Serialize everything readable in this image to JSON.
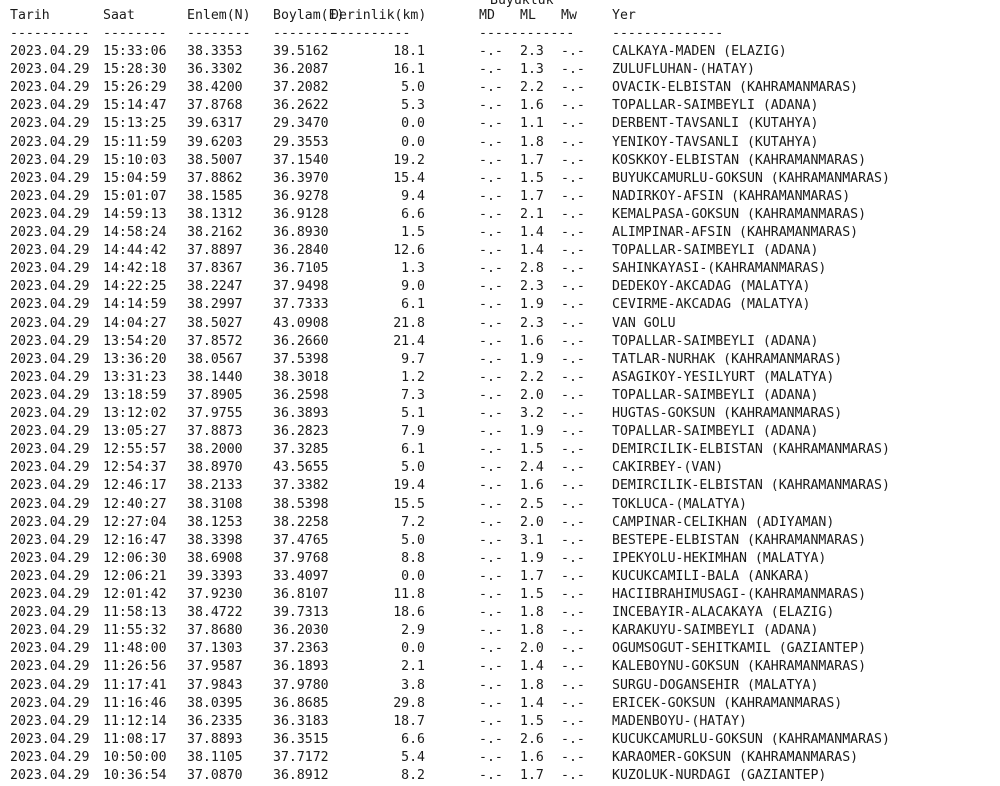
{
  "group_header": "Büyüklük",
  "headers": {
    "date": "Tarih",
    "time": "Saat",
    "lat": "Enlem(N)",
    "lon": "Boylam(E)",
    "depth": "Derinlik(km)",
    "md": "MD",
    "ml": "ML",
    "mw": "Mw",
    "place": "Yer"
  },
  "separators": {
    "date": "----------",
    "time": "--------",
    "lat": "--------",
    "lon": "--------",
    "depth": "----------",
    "mag": "------------",
    "place": "--------------"
  },
  "rows": [
    {
      "date": "2023.04.29",
      "time": "15:33:06",
      "lat": "38.3353",
      "lon": "39.5162",
      "depth": "18.1",
      "md": "-.-",
      "ml": "2.3",
      "mw": "-.-",
      "place": "CALKAYA-MADEN (ELAZIG)"
    },
    {
      "date": "2023.04.29",
      "time": "15:28:30",
      "lat": "36.3302",
      "lon": "36.2087",
      "depth": "16.1",
      "md": "-.-",
      "ml": "1.3",
      "mw": "-.-",
      "place": "ZULUFLUHAN-(HATAY)"
    },
    {
      "date": "2023.04.29",
      "time": "15:26:29",
      "lat": "38.4200",
      "lon": "37.2082",
      "depth": "5.0",
      "md": "-.-",
      "ml": "2.2",
      "mw": "-.-",
      "place": "OVACIK-ELBISTAN (KAHRAMANMARAS)"
    },
    {
      "date": "2023.04.29",
      "time": "15:14:47",
      "lat": "37.8768",
      "lon": "36.2622",
      "depth": "5.3",
      "md": "-.-",
      "ml": "1.6",
      "mw": "-.-",
      "place": "TOPALLAR-SAIMBEYLI (ADANA)"
    },
    {
      "date": "2023.04.29",
      "time": "15:13:25",
      "lat": "39.6317",
      "lon": "29.3470",
      "depth": "0.0",
      "md": "-.-",
      "ml": "1.1",
      "mw": "-.-",
      "place": "DERBENT-TAVSANLI (KUTAHYA)"
    },
    {
      "date": "2023.04.29",
      "time": "15:11:59",
      "lat": "39.6203",
      "lon": "29.3553",
      "depth": "0.0",
      "md": "-.-",
      "ml": "1.8",
      "mw": "-.-",
      "place": "YENIKOY-TAVSANLI (KUTAHYA)"
    },
    {
      "date": "2023.04.29",
      "time": "15:10:03",
      "lat": "38.5007",
      "lon": "37.1540",
      "depth": "19.2",
      "md": "-.-",
      "ml": "1.7",
      "mw": "-.-",
      "place": "KOSKKOY-ELBISTAN (KAHRAMANMARAS)"
    },
    {
      "date": "2023.04.29",
      "time": "15:04:59",
      "lat": "37.8862",
      "lon": "36.3970",
      "depth": "15.4",
      "md": "-.-",
      "ml": "1.5",
      "mw": "-.-",
      "place": "BUYUKCAMURLU-GOKSUN (KAHRAMANMARAS)"
    },
    {
      "date": "2023.04.29",
      "time": "15:01:07",
      "lat": "38.1585",
      "lon": "36.9278",
      "depth": "9.4",
      "md": "-.-",
      "ml": "1.7",
      "mw": "-.-",
      "place": "NADIRKOY-AFSIN (KAHRAMANMARAS)"
    },
    {
      "date": "2023.04.29",
      "time": "14:59:13",
      "lat": "38.1312",
      "lon": "36.9128",
      "depth": "6.6",
      "md": "-.-",
      "ml": "2.1",
      "mw": "-.-",
      "place": "KEMALPASA-GOKSUN (KAHRAMANMARAS)"
    },
    {
      "date": "2023.04.29",
      "time": "14:58:24",
      "lat": "38.2162",
      "lon": "36.8930",
      "depth": "1.5",
      "md": "-.-",
      "ml": "1.4",
      "mw": "-.-",
      "place": "ALIMPINAR-AFSIN (KAHRAMANMARAS)"
    },
    {
      "date": "2023.04.29",
      "time": "14:44:42",
      "lat": "37.8897",
      "lon": "36.2840",
      "depth": "12.6",
      "md": "-.-",
      "ml": "1.4",
      "mw": "-.-",
      "place": "TOPALLAR-SAIMBEYLI (ADANA)"
    },
    {
      "date": "2023.04.29",
      "time": "14:42:18",
      "lat": "37.8367",
      "lon": "36.7105",
      "depth": "1.3",
      "md": "-.-",
      "ml": "2.8",
      "mw": "-.-",
      "place": "SAHINKAYASI-(KAHRAMANMARAS)"
    },
    {
      "date": "2023.04.29",
      "time": "14:22:25",
      "lat": "38.2247",
      "lon": "37.9498",
      "depth": "9.0",
      "md": "-.-",
      "ml": "2.3",
      "mw": "-.-",
      "place": "DEDEKOY-AKCADAG (MALATYA)"
    },
    {
      "date": "2023.04.29",
      "time": "14:14:59",
      "lat": "38.2997",
      "lon": "37.7333",
      "depth": "6.1",
      "md": "-.-",
      "ml": "1.9",
      "mw": "-.-",
      "place": "CEVIRME-AKCADAG (MALATYA)"
    },
    {
      "date": "2023.04.29",
      "time": "14:04:27",
      "lat": "38.5027",
      "lon": "43.0908",
      "depth": "21.8",
      "md": "-.-",
      "ml": "2.3",
      "mw": "-.-",
      "place": "VAN GOLU"
    },
    {
      "date": "2023.04.29",
      "time": "13:54:20",
      "lat": "37.8572",
      "lon": "36.2660",
      "depth": "21.4",
      "md": "-.-",
      "ml": "1.6",
      "mw": "-.-",
      "place": "TOPALLAR-SAIMBEYLI (ADANA)"
    },
    {
      "date": "2023.04.29",
      "time": "13:36:20",
      "lat": "38.0567",
      "lon": "37.5398",
      "depth": "9.7",
      "md": "-.-",
      "ml": "1.9",
      "mw": "-.-",
      "place": "TATLAR-NURHAK (KAHRAMANMARAS)"
    },
    {
      "date": "2023.04.29",
      "time": "13:31:23",
      "lat": "38.1440",
      "lon": "38.3018",
      "depth": "1.2",
      "md": "-.-",
      "ml": "2.2",
      "mw": "-.-",
      "place": "ASAGIKOY-YESILYURT (MALATYA)"
    },
    {
      "date": "2023.04.29",
      "time": "13:18:59",
      "lat": "37.8905",
      "lon": "36.2598",
      "depth": "7.3",
      "md": "-.-",
      "ml": "2.0",
      "mw": "-.-",
      "place": "TOPALLAR-SAIMBEYLI (ADANA)"
    },
    {
      "date": "2023.04.29",
      "time": "13:12:02",
      "lat": "37.9755",
      "lon": "36.3893",
      "depth": "5.1",
      "md": "-.-",
      "ml": "3.2",
      "mw": "-.-",
      "place": "HUGTAS-GOKSUN (KAHRAMANMARAS)"
    },
    {
      "date": "2023.04.29",
      "time": "13:05:27",
      "lat": "37.8873",
      "lon": "36.2823",
      "depth": "7.9",
      "md": "-.-",
      "ml": "1.9",
      "mw": "-.-",
      "place": "TOPALLAR-SAIMBEYLI (ADANA)"
    },
    {
      "date": "2023.04.29",
      "time": "12:55:57",
      "lat": "38.2000",
      "lon": "37.3285",
      "depth": "6.1",
      "md": "-.-",
      "ml": "1.5",
      "mw": "-.-",
      "place": "DEMIRCILIK-ELBISTAN (KAHRAMANMARAS)"
    },
    {
      "date": "2023.04.29",
      "time": "12:54:37",
      "lat": "38.8970",
      "lon": "43.5655",
      "depth": "5.0",
      "md": "-.-",
      "ml": "2.4",
      "mw": "-.-",
      "place": "CAKIRBEY-(VAN)"
    },
    {
      "date": "2023.04.29",
      "time": "12:46:17",
      "lat": "38.2133",
      "lon": "37.3382",
      "depth": "19.4",
      "md": "-.-",
      "ml": "1.6",
      "mw": "-.-",
      "place": "DEMIRCILIK-ELBISTAN (KAHRAMANMARAS)"
    },
    {
      "date": "2023.04.29",
      "time": "12:40:27",
      "lat": "38.3108",
      "lon": "38.5398",
      "depth": "15.5",
      "md": "-.-",
      "ml": "2.5",
      "mw": "-.-",
      "place": "TOKLUCA-(MALATYA)"
    },
    {
      "date": "2023.04.29",
      "time": "12:27:04",
      "lat": "38.1253",
      "lon": "38.2258",
      "depth": "7.2",
      "md": "-.-",
      "ml": "2.0",
      "mw": "-.-",
      "place": "CAMPINAR-CELIKHAN (ADIYAMAN)"
    },
    {
      "date": "2023.04.29",
      "time": "12:16:47",
      "lat": "38.3398",
      "lon": "37.4765",
      "depth": "5.0",
      "md": "-.-",
      "ml": "3.1",
      "mw": "-.-",
      "place": "BESTEPE-ELBISTAN (KAHRAMANMARAS)"
    },
    {
      "date": "2023.04.29",
      "time": "12:06:30",
      "lat": "38.6908",
      "lon": "37.9768",
      "depth": "8.8",
      "md": "-.-",
      "ml": "1.9",
      "mw": "-.-",
      "place": "IPEKYOLU-HEKIMHAN (MALATYA)"
    },
    {
      "date": "2023.04.29",
      "time": "12:06:21",
      "lat": "39.3393",
      "lon": "33.4097",
      "depth": "0.0",
      "md": "-.-",
      "ml": "1.7",
      "mw": "-.-",
      "place": "KUCUKCAMILI-BALA (ANKARA)"
    },
    {
      "date": "2023.04.29",
      "time": "12:01:42",
      "lat": "37.9230",
      "lon": "36.8107",
      "depth": "11.8",
      "md": "-.-",
      "ml": "1.5",
      "mw": "-.-",
      "place": "HACIIBRAHIMUSAGI-(KAHRAMANMARAS)"
    },
    {
      "date": "2023.04.29",
      "time": "11:58:13",
      "lat": "38.4722",
      "lon": "39.7313",
      "depth": "18.6",
      "md": "-.-",
      "ml": "1.8",
      "mw": "-.-",
      "place": "INCEBAYIR-ALACAKAYA (ELAZIG)"
    },
    {
      "date": "2023.04.29",
      "time": "11:55:32",
      "lat": "37.8680",
      "lon": "36.2030",
      "depth": "2.9",
      "md": "-.-",
      "ml": "1.8",
      "mw": "-.-",
      "place": "KARAKUYU-SAIMBEYLI (ADANA)"
    },
    {
      "date": "2023.04.29",
      "time": "11:48:00",
      "lat": "37.1303",
      "lon": "37.2363",
      "depth": "0.0",
      "md": "-.-",
      "ml": "2.0",
      "mw": "-.-",
      "place": "OGUMSOGUT-SEHITKAMIL (GAZIANTEP)"
    },
    {
      "date": "2023.04.29",
      "time": "11:26:56",
      "lat": "37.9587",
      "lon": "36.1893",
      "depth": "2.1",
      "md": "-.-",
      "ml": "1.4",
      "mw": "-.-",
      "place": "KALEBOYNU-GOKSUN (KAHRAMANMARAS)"
    },
    {
      "date": "2023.04.29",
      "time": "11:17:41",
      "lat": "37.9843",
      "lon": "37.9780",
      "depth": "3.8",
      "md": "-.-",
      "ml": "1.8",
      "mw": "-.-",
      "place": "SURGU-DOGANSEHIR (MALATYA)"
    },
    {
      "date": "2023.04.29",
      "time": "11:16:46",
      "lat": "38.0395",
      "lon": "36.8685",
      "depth": "29.8",
      "md": "-.-",
      "ml": "1.4",
      "mw": "-.-",
      "place": "ERICEK-GOKSUN (KAHRAMANMARAS)"
    },
    {
      "date": "2023.04.29",
      "time": "11:12:14",
      "lat": "36.2335",
      "lon": "36.3183",
      "depth": "18.7",
      "md": "-.-",
      "ml": "1.5",
      "mw": "-.-",
      "place": "MADENBOYU-(HATAY)"
    },
    {
      "date": "2023.04.29",
      "time": "11:08:17",
      "lat": "37.8893",
      "lon": "36.3515",
      "depth": "6.6",
      "md": "-.-",
      "ml": "2.6",
      "mw": "-.-",
      "place": "KUCUKCAMURLU-GOKSUN (KAHRAMANMARAS)"
    },
    {
      "date": "2023.04.29",
      "time": "10:50:00",
      "lat": "38.1105",
      "lon": "37.7172",
      "depth": "5.4",
      "md": "-.-",
      "ml": "1.6",
      "mw": "-.-",
      "place": "KARAOMER-GOKSUN (KAHRAMANMARAS)"
    },
    {
      "date": "2023.04.29",
      "time": "10:36:54",
      "lat": "37.0870",
      "lon": "36.8912",
      "depth": "8.2",
      "md": "-.-",
      "ml": "1.7",
      "mw": "-.-",
      "place": "KUZOLUK-NURDAGI (GAZIANTEP)"
    }
  ]
}
